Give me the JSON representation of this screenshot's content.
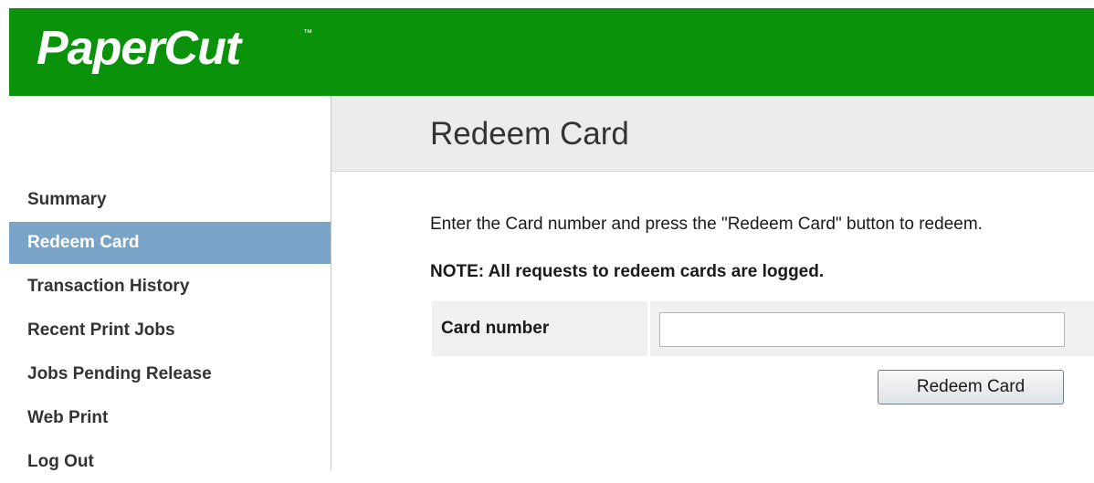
{
  "app": {
    "logo_text": "PaperCut",
    "logo_tm": "™",
    "brand_color": "#0b920b",
    "active_nav_color": "#7aa4c7"
  },
  "sidebar": {
    "items": [
      {
        "label": "Summary",
        "active": false
      },
      {
        "label": "Redeem Card",
        "active": true
      },
      {
        "label": "Transaction History",
        "active": false
      },
      {
        "label": "Recent Print Jobs",
        "active": false
      },
      {
        "label": "Jobs Pending Release",
        "active": false
      },
      {
        "label": "Web Print",
        "active": false
      },
      {
        "label": "Log Out",
        "active": false
      }
    ]
  },
  "main": {
    "title": "Redeem Card",
    "instructions": "Enter the Card number and press the \"Redeem Card\" button to redeem.",
    "note": "NOTE: All requests to redeem cards are logged.",
    "form": {
      "card_label": "Card number",
      "card_value": "",
      "card_placeholder": "",
      "submit_label": "Redeem Card"
    }
  }
}
